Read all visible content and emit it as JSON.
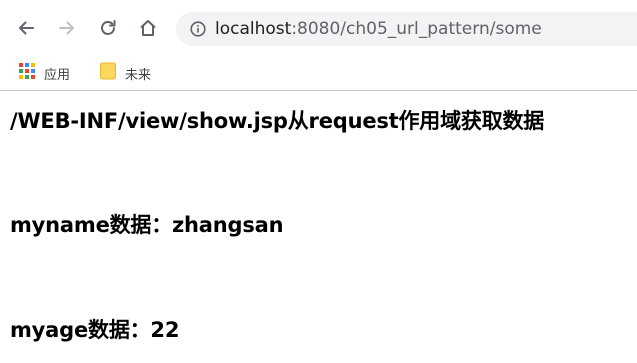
{
  "browser": {
    "url_host": "localhost",
    "url_path": ":8080/ch05_url_pattern/some",
    "icons": {
      "back": "back-arrow-icon",
      "forward": "forward-arrow-icon",
      "reload": "reload-icon",
      "home": "home-icon",
      "info": "info-icon"
    }
  },
  "bookmarks": {
    "items": [
      {
        "label": "应用",
        "icon": "apps-grid-icon"
      },
      {
        "label": "未来",
        "icon": "folder-icon"
      }
    ]
  },
  "page": {
    "title": "/WEB-INF/view/show.jsp从request作用域获取数据",
    "myname_line": "myname数据：zhangsan",
    "myage_line": "myage数据：22"
  },
  "colors": {
    "omnibox_bg": "#f1f3f4",
    "icon_gray": "#5f6368",
    "folder_yellow": "#fbd75b"
  }
}
